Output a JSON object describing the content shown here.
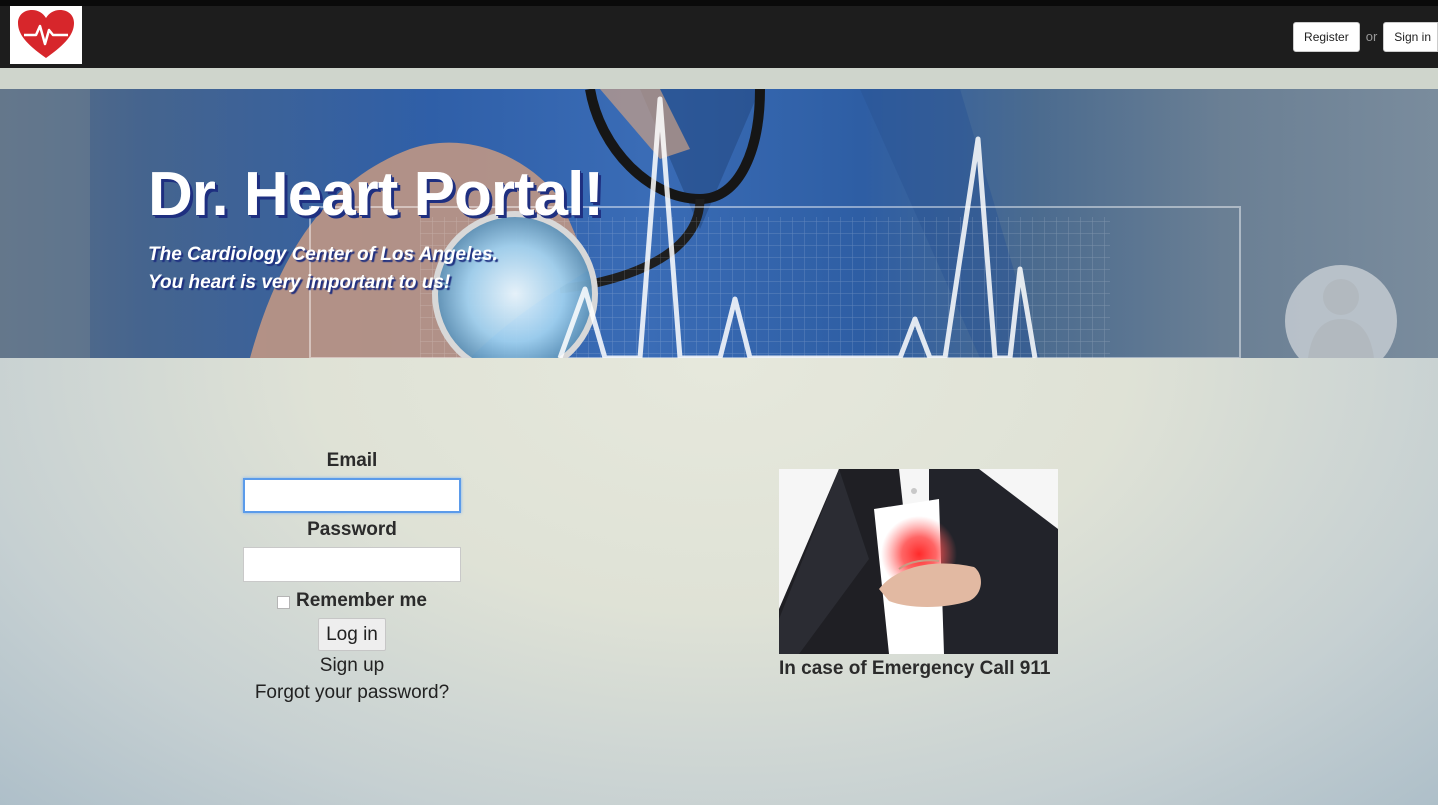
{
  "header": {
    "logo_alt": "Dr. Heart logo",
    "register_label": "Register",
    "or_text": "or",
    "signin_label": "Sign in"
  },
  "hero": {
    "title": "Dr. Heart Portal!",
    "subtitle_line1": "The Cardiology Center of Los Angeles.",
    "subtitle_line2": "You heart is very important to us!"
  },
  "login": {
    "email_label": "Email",
    "email_value": "",
    "password_label": "Password",
    "password_value": "",
    "remember_label": "Remember me",
    "remember_checked": false,
    "login_button": "Log in",
    "signup_link": "Sign up",
    "forgot_link": "Forgot your password?"
  },
  "emergency": {
    "caption": "In case of Emergency Call 911"
  },
  "colors": {
    "topbar": "#1d1d1d",
    "logo_heart": "#d7262b",
    "hero_blue": "#2f5fa8",
    "title_shadow": "#1e2f80",
    "focus_ring": "#5b9bea"
  }
}
